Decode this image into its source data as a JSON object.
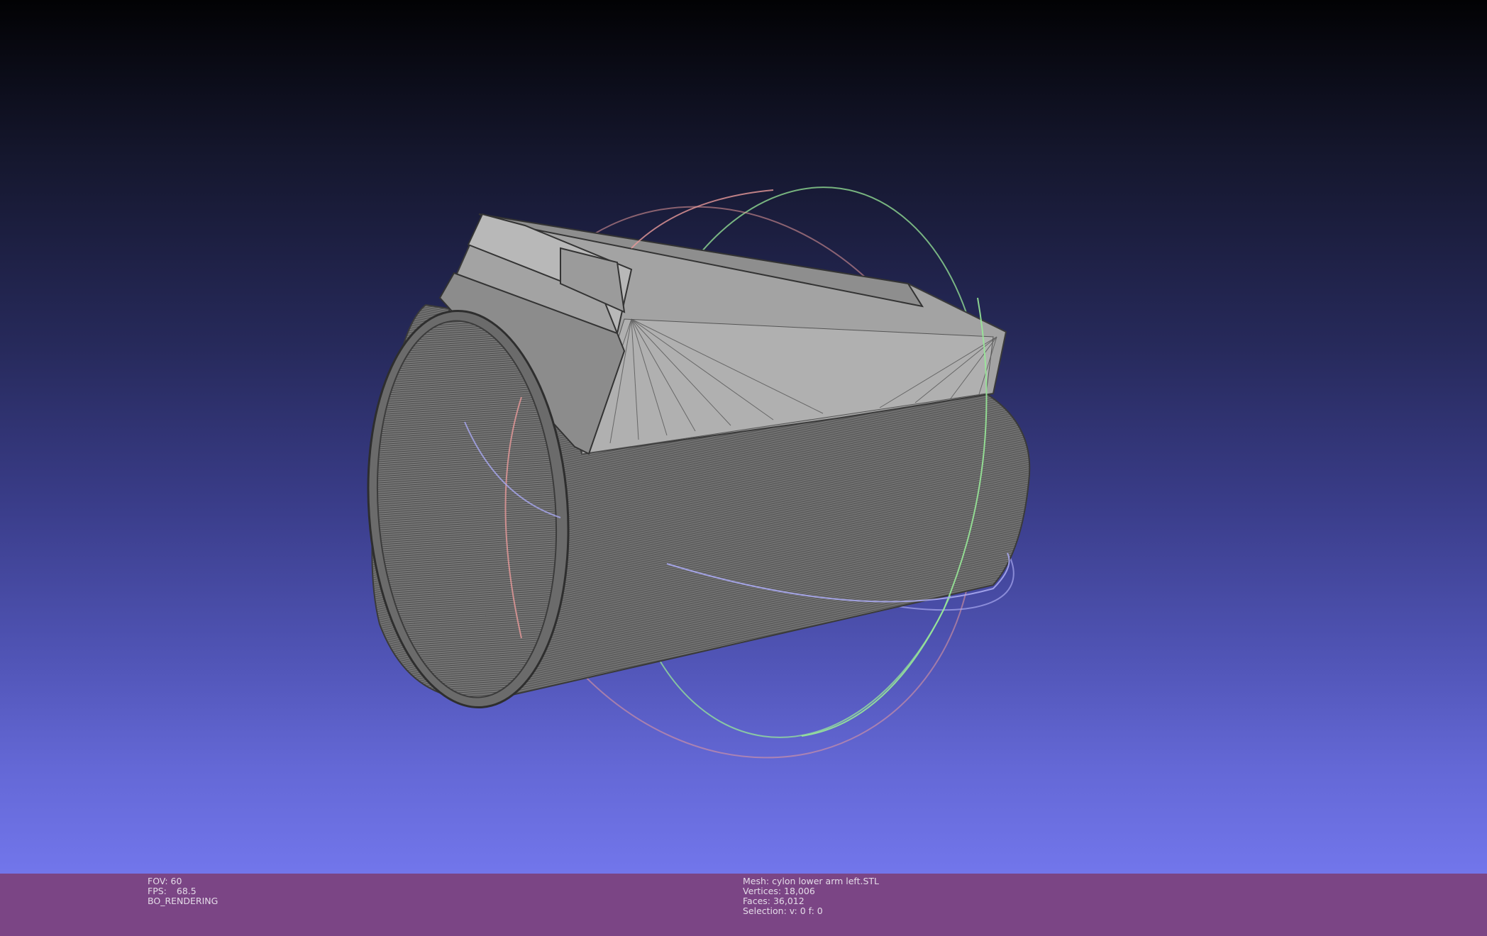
{
  "viewer": {
    "gradient_top": "#020204",
    "gradient_bottom": "#7276eb",
    "mesh_color": "#9a9a9a",
    "statusbar_color": "#7b4585"
  },
  "render_info": {
    "fov": "FOV: 60",
    "fps_label": "FPS:",
    "fps_value": "68.5",
    "mode": "BO_RENDERING"
  },
  "mesh_info": {
    "mesh": "Mesh: cylon lower arm left.STL",
    "vertices": "Vertices: 18,006",
    "faces": "Faces: 36,012",
    "selection": "Selection: v: 0 f: 0"
  },
  "trackball": {
    "x_axis_color": "#e89a9a",
    "y_axis_color": "#98e898",
    "z_axis_color": "#a8a8f0"
  }
}
